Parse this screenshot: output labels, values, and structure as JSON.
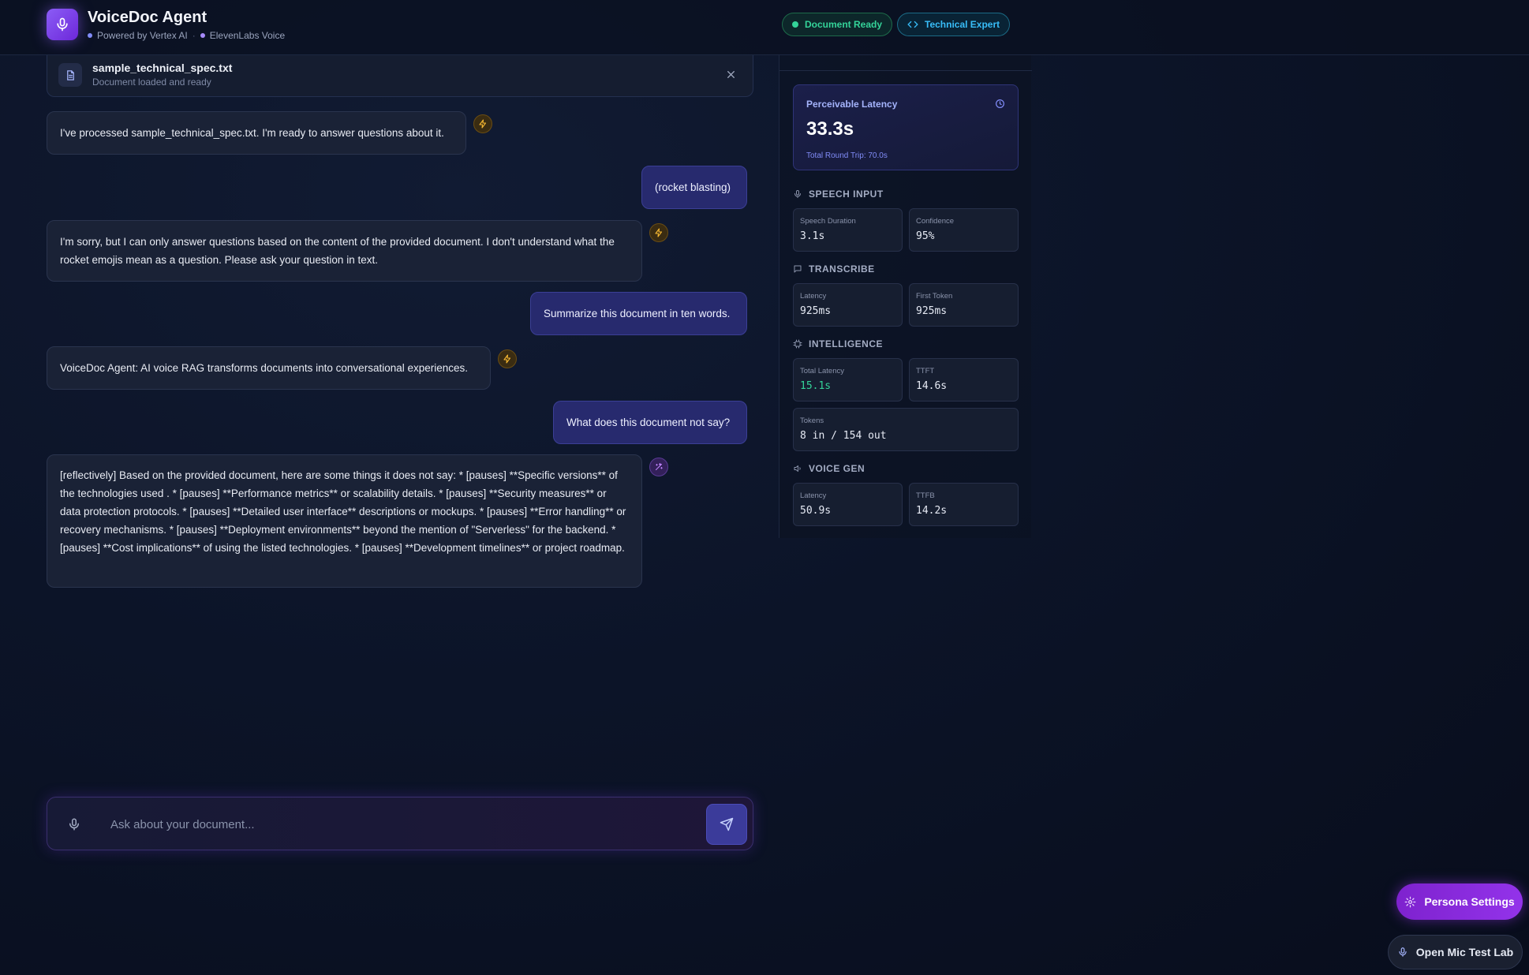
{
  "header": {
    "app_title": "VoiceDoc Agent",
    "powered_by": "Powered by Vertex AI",
    "separator": "·",
    "voice_provider": "ElevenLabs Voice",
    "badges": {
      "document_ready": "Document Ready",
      "persona": "Technical Expert"
    }
  },
  "document": {
    "name": "sample_technical_spec.txt",
    "status": "Document loaded and ready"
  },
  "messages": [
    {
      "role": "agent",
      "icon": "bolt-icon",
      "text": "I've processed sample_technical_spec.txt. I'm ready to answer questions about it."
    },
    {
      "role": "user",
      "text": "(rocket blasting)"
    },
    {
      "role": "agent",
      "icon": "bolt-icon",
      "text": "I'm sorry, but I can only answer questions based on the content of the provided document. I don't understand what the rocket emojis mean as a question. Please ask your question in text."
    },
    {
      "role": "user",
      "text": "Summarize this document in ten words."
    },
    {
      "role": "agent",
      "icon": "bolt-icon",
      "text": "VoiceDoc Agent: AI voice RAG transforms documents into conversational experiences."
    },
    {
      "role": "user",
      "text": "What does this document not say?"
    },
    {
      "role": "agent",
      "icon": "sparkle-icon",
      "text": "[reflectively] Based on the provided document, here are some things it does not say: * [pauses] **Specific versions** of the technologies used . * [pauses] **Performance metrics** or scalability details. * [pauses] **Security measures** or data protection protocols. * [pauses] **Detailed user interface** descriptions or mockups. * [pauses] **Error handling** or recovery mechanisms. * [pauses] **Deployment environments** beyond the mention of \"Serverless\" for the backend. * [pauses] **Cost implications** of using the listed technologies. * [pauses] **Development timelines** or project roadmap."
    }
  ],
  "input": {
    "placeholder": "Ask about your document..."
  },
  "metrics": {
    "perceivable_latency": {
      "label": "Perceivable Latency",
      "value": "33.3s",
      "subtext": "Total Round Trip: 70.0s"
    },
    "speech_input": {
      "title": "SPEECH INPUT",
      "duration_label": "Speech Duration",
      "duration_value": "3.1s",
      "confidence_label": "Confidence",
      "confidence_value": "95%"
    },
    "transcribe": {
      "title": "TRANSCRIBE",
      "latency_label": "Latency",
      "latency_value": "925ms",
      "first_token_label": "First Token",
      "first_token_value": "925ms"
    },
    "intelligence": {
      "title": "INTELLIGENCE",
      "total_latency_label": "Total Latency",
      "total_latency_value": "15.1s",
      "ttft_label": "TTFT",
      "ttft_value": "14.6s",
      "tokens_label": "Tokens",
      "tokens_value": "8 in / 154 out"
    },
    "voice_gen": {
      "title": "VOICE GEN",
      "latency_label": "Latency",
      "latency_value": "50.9s",
      "ttfb_label": "TTFB",
      "ttfb_value": "14.2s"
    }
  },
  "buttons": {
    "persona_settings": "Persona Settings",
    "open_mic_test_lab": "Open Mic Test Lab"
  },
  "colors": {
    "accent": "#8b5cf6",
    "ready_green": "#34d399",
    "expert_cyan": "#38bdf8",
    "user_bubble": "#272a6e",
    "agent_bubble": "#1a2236"
  }
}
